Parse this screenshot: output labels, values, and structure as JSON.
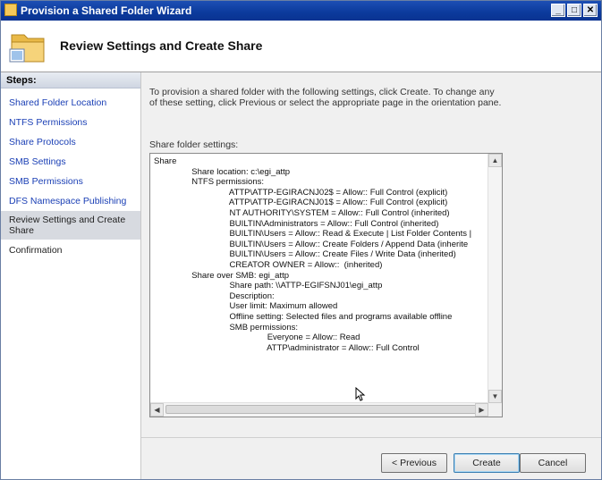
{
  "window": {
    "title": "Provision a Shared Folder Wizard",
    "controls": {
      "minimize": "_",
      "maximize": "□",
      "close": "✕"
    }
  },
  "header": {
    "title": "Review Settings and Create Share",
    "icon": "folder-icon"
  },
  "sidebar": {
    "heading": "Steps:",
    "items": [
      {
        "label": "Shared Folder Location",
        "state": "link"
      },
      {
        "label": "NTFS Permissions",
        "state": "link"
      },
      {
        "label": "Share Protocols",
        "state": "link"
      },
      {
        "label": "SMB Settings",
        "state": "link"
      },
      {
        "label": "SMB Permissions",
        "state": "link"
      },
      {
        "label": "DFS Namespace Publishing",
        "state": "link"
      },
      {
        "label": "Review Settings and Create Share",
        "state": "current"
      },
      {
        "label": "Confirmation",
        "state": "plain"
      }
    ]
  },
  "main": {
    "instructions": "To provision a shared folder with the following settings, click Create. To change any of these setting, click Previous or select the appropriate page in the orientation pane.",
    "settings_label": "Share folder settings:",
    "settings_lines": [
      "Share",
      "                Share location: c:\\egi_attp",
      "                NTFS permissions:",
      "                                ATTP\\ATTP-EGIRACNJ02$ = Allow:: Full Control (explicit)",
      "                                ATTP\\ATTP-EGIRACNJ01$ = Allow:: Full Control (explicit)",
      "                                NT AUTHORITY\\SYSTEM = Allow:: Full Control (inherited)",
      "                                BUILTIN\\Administrators = Allow:: Full Control (inherited)",
      "                                BUILTIN\\Users = Allow:: Read & Execute | List Folder Contents |",
      "                                BUILTIN\\Users = Allow:: Create Folders / Append Data (inherite",
      "                                BUILTIN\\Users = Allow:: Create Files / Write Data (inherited)",
      "                                CREATOR OWNER = Allow::  (inherited)",
      "                Share over SMB: egi_attp",
      "                                Share path: \\\\ATTP-EGIFSNJ01\\egi_attp",
      "                                Description:",
      "                                User limit: Maximum allowed",
      "                                Offline setting: Selected files and programs available offline",
      "                                SMB permissions:",
      "                                                Everyone = Allow:: Read",
      "                                                ATTP\\administrator = Allow:: Full Control"
    ]
  },
  "buttons": {
    "previous": "< Previous",
    "create": "Create",
    "cancel": "Cancel"
  },
  "colors": {
    "titlebar": "#0b3a9c",
    "link": "#1a3fb5",
    "current_step_bg": "#d7dae0"
  }
}
